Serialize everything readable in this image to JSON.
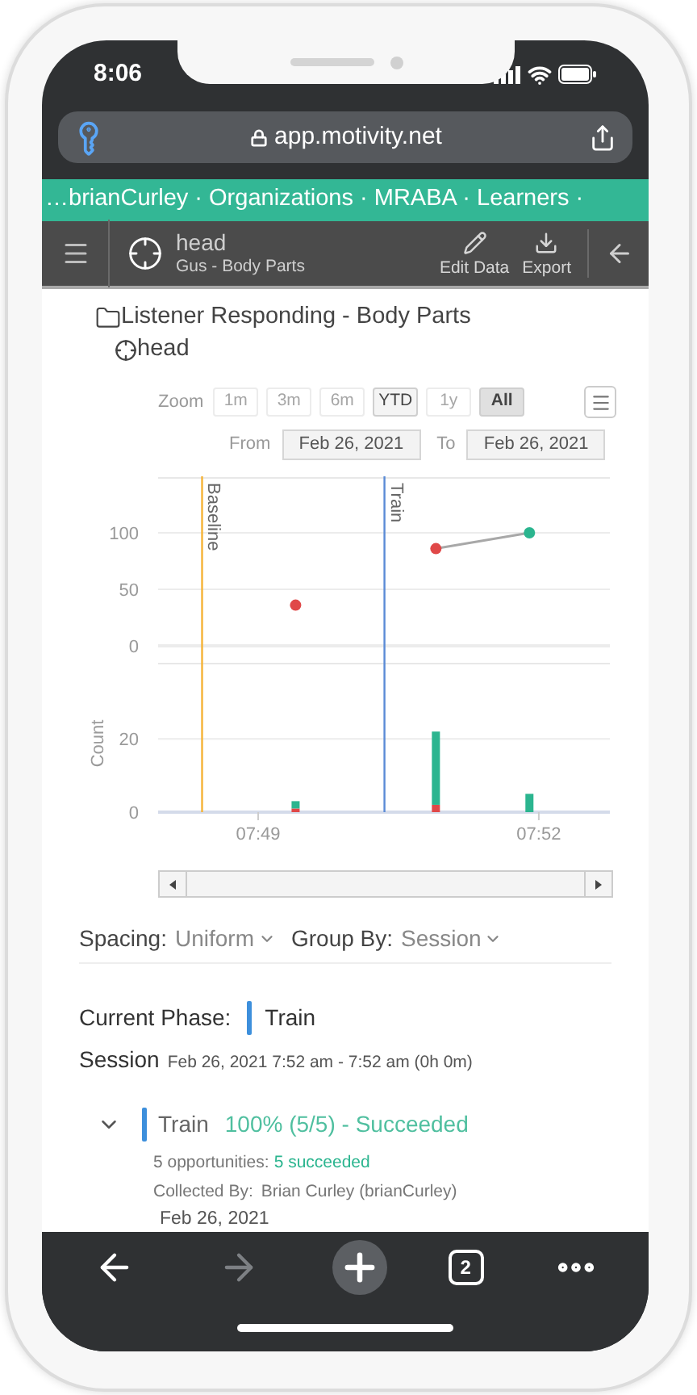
{
  "status_bar": {
    "time": "8:06"
  },
  "address_bar": {
    "url": "app.motivity.net"
  },
  "breadcrumb": "…brianCurley · Organizations · MRABA · Learners ·",
  "header": {
    "title": "head",
    "subtitle": "Gus - Body Parts",
    "actions": [
      {
        "kind": "edit",
        "label": "Edit Data"
      },
      {
        "kind": "export",
        "label": "Export"
      }
    ]
  },
  "program": {
    "folder": "Listener Responding - Body Parts",
    "target": "head"
  },
  "zoom": {
    "label": "Zoom",
    "options": [
      {
        "label": "1m",
        "disabled": true,
        "selected": false
      },
      {
        "label": "3m",
        "disabled": true,
        "selected": false
      },
      {
        "label": "6m",
        "disabled": true,
        "selected": false
      },
      {
        "label": "YTD",
        "disabled": false,
        "selected": false
      },
      {
        "label": "1y",
        "disabled": true,
        "selected": false
      },
      {
        "label": "All",
        "disabled": false,
        "selected": true
      }
    ]
  },
  "date_range": {
    "from_label": "From",
    "from": "Feb 26, 2021",
    "to_label": "To",
    "to": "Feb 26, 2021"
  },
  "percent_chart": {
    "chart_data": {
      "type": "scatter",
      "x": [
        469.4,
        470.9,
        471.9
      ],
      "xlim": [
        467.93,
        472.76
      ],
      "ylim": [
        0,
        150
      ],
      "yticks": [
        0,
        50,
        100
      ],
      "series": [
        {
          "type": "line",
          "color": "#a8a8a8",
          "values": [
            null,
            86,
            100
          ]
        },
        {
          "color": "#e04848",
          "values": [
            36,
            86,
            null
          ]
        },
        {
          "color": "#2bb58f",
          "values": [
            null,
            null,
            100
          ]
        }
      ],
      "ref_lines": [
        {
          "axis": "x",
          "value": 468.4,
          "label": "Baseline"
        },
        {
          "axis": "x",
          "value": 470.35,
          "label": "Train"
        }
      ]
    }
  },
  "count_chart": {
    "chart_data": {
      "type": "bar",
      "stacked": true,
      "ylabel": "Count",
      "x": [
        469.4,
        470.9,
        471.9
      ],
      "xlim": [
        467.93,
        472.76
      ],
      "ylim": [
        0,
        41
      ],
      "yticks": [
        0,
        20
      ],
      "xticks": [
        {
          "value": 469,
          "label": "07:49"
        },
        {
          "value": 472,
          "label": "07:52"
        }
      ],
      "series": [
        {
          "color": "#e04848",
          "values": [
            1,
            2,
            0
          ]
        },
        {
          "color": "#2bb58f",
          "values": [
            2,
            20,
            5
          ]
        }
      ],
      "ref_lines": [
        {
          "axis": "x",
          "value": 468.4
        },
        {
          "axis": "x",
          "value": 470.35
        }
      ]
    }
  },
  "options": [
    {
      "label": "Spacing:",
      "value": "Uniform"
    },
    {
      "label": "Group By:",
      "value": "Session"
    }
  ],
  "current_phase": {
    "label": "Current Phase:",
    "phase": "Train"
  },
  "session": {
    "label": "Session",
    "time": "Feb 26, 2021 7:52 am - 7:52 am (0h 0m)"
  },
  "phase_result": {
    "expanded": true,
    "phase": "Train",
    "result": "100% (5/5) - Succeeded",
    "opportunities": "5 opportunities:",
    "succeeded": "5 succeeded",
    "collected_label": "Collected By:",
    "collected_by": "Brian Curley (brianCurley)"
  },
  "next_date": "Feb 26, 2021",
  "toolbar": [
    {
      "kind": "back",
      "disabled": false
    },
    {
      "kind": "forward",
      "disabled": true
    },
    {
      "kind": "new",
      "disabled": false
    },
    {
      "kind": "tabs",
      "label": "2",
      "disabled": false
    },
    {
      "kind": "more",
      "disabled": false
    }
  ]
}
